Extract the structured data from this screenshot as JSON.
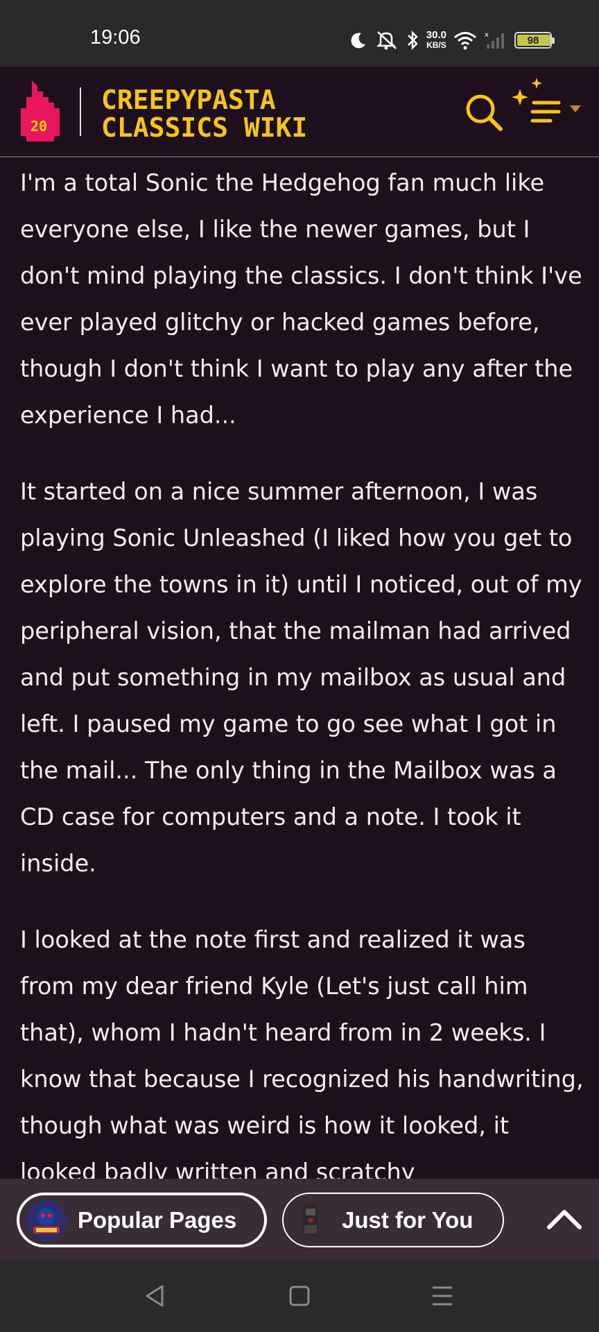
{
  "status_bar": {
    "time": "19:06",
    "net_speed_value": "30.0",
    "net_speed_unit": "KB/S",
    "battery_level": "98",
    "icons": [
      "moon-icon",
      "mute-icon",
      "bluetooth-icon",
      "wifi-icon",
      "signal-icon"
    ]
  },
  "header": {
    "logo_number": "20",
    "title_line1": "CREEPYPASTA",
    "title_line2": "CLASSICS WIKI",
    "accent_color": "#f5c518",
    "logo_color": "#e8175d"
  },
  "article": {
    "paragraphs": [
      "I'm a total Sonic the Hedgehog fan much like everyone else, I like the newer games, but I don't mind playing the classics. I don't think I've ever played glitchy or hacked games before, though I don't think I want to play any after the experience I had...",
      "It started on a nice summer afternoon, I was playing Sonic Unleashed (I liked how you get to explore the towns in it) until I noticed, out of my peripheral vision, that the mailman had arrived and put something in my mailbox as usual and left. I paused my game to go see what I got in the mail... The only thing in the Mailbox was a CD case for computers and a note. I took it inside.",
      "I looked at the note first and realized it was from my dear friend Kyle (Let's just call him that), whom I hadn't heard from in 2 weeks. I know that because I recognized his handwriting, though what was weird is how it looked, it looked badly written and scratchy"
    ]
  },
  "bottom_bar": {
    "popular_label": "Popular Pages",
    "for_you_label": "Just for You"
  },
  "colors": {
    "background": "#1e0f1c",
    "status_bar": "#2a2a2c",
    "bottom_bar": "#3a2c37"
  }
}
